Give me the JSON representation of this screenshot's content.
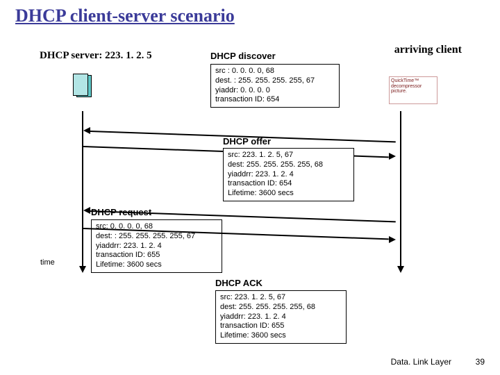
{
  "title": "DHCP client-server scenario",
  "server_label": "DHCP server: 223. 1. 2. 5",
  "arriving_client": "arriving\nclient",
  "client_icon_alt": "QuickTime™ decompressor picture.",
  "time_label": "time",
  "footer": "Data. Link Layer",
  "page": "39",
  "messages": {
    "discover": {
      "title": "DHCP discover",
      "body": "src : 0. 0. 0. 0, 68\ndest. : 255. 255. 255. 255, 67\nyiaddr:    0. 0. 0. 0\ntransaction ID: 654"
    },
    "offer": {
      "title": "DHCP offer",
      "body": "src: 223. 1. 2. 5, 67\ndest:  255. 255. 255. 255, 68\nyiaddrr: 223. 1. 2. 4\ntransaction ID: 654\nLifetime: 3600 secs"
    },
    "request": {
      "title": "DHCP request",
      "body": "src:  0. 0. 0. 0, 68\ndest: :  255. 255. 255. 255, 67\nyiaddrr: 223. 1. 2. 4\ntransaction ID: 655\nLifetime: 3600 secs"
    },
    "ack": {
      "title": "DHCP ACK",
      "body": "src: 223. 1. 2. 5, 67\ndest:  255. 255. 255. 255, 68\nyiaddrr: 223. 1. 2. 4\ntransaction ID: 655\nLifetime: 3600 secs"
    }
  }
}
